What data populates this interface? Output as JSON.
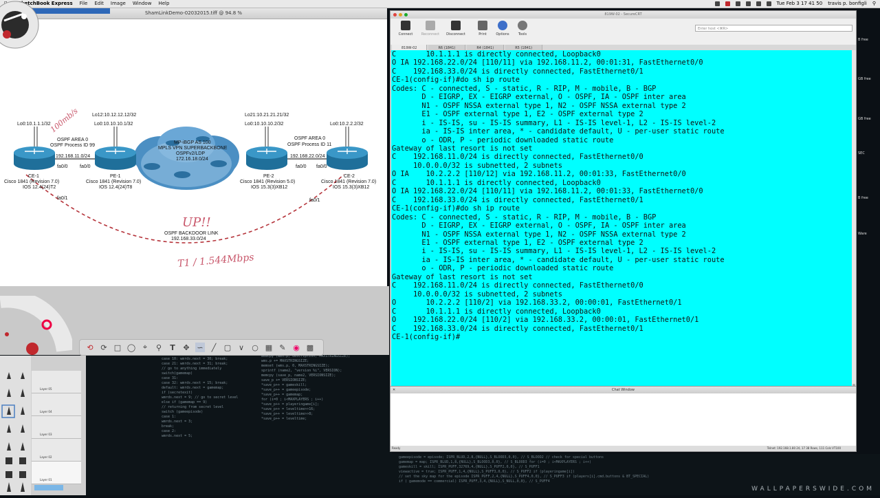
{
  "menubar": {
    "app_name": "SketchBook Express",
    "items": [
      "File",
      "Edit",
      "Image",
      "Window",
      "Help"
    ],
    "clock": "Tue Feb 3  17 41 50",
    "user": "travis p. bonfigli"
  },
  "sketchbook": {
    "window_title": "ShamLinkDemo-02032015.tiff @ 94.8 %",
    "layers": [
      "Layer 05",
      "Layer 04",
      "Layer 03",
      "Layer 02",
      "Layer 01"
    ]
  },
  "diagram": {
    "ce1_lo": "Lo0:10.1.1.1/32",
    "pe1_lo12": "Lo12:10.12.12.12/32",
    "pe1_lo0": "Lo0:10.10.10.1/32",
    "pe2_lo21": "Lo21:10.21.21.21/32",
    "pe2_lo0": "Lo0:10.10.10.2/32",
    "ce2_lo": "Lo0:10.2.2.2/32",
    "ospf_area_left": "OSPF AREA 0",
    "ospf_proc_left": "OSPF Process ID 99",
    "ospf_area_right": "OSPF AREA 0",
    "ospf_proc_right": "OSPF Process ID 11",
    "net_left": "192.168.11.0/24",
    "net_right": "192.168.22.0/24",
    "fa_a": "fa0/0",
    "fa_b": "fa0/0",
    "fa_c": "fa0/0",
    "fa_d": "fa0/0",
    "cloud_1": "MP-iBGP AS 100",
    "cloud_2": "MPLS VPN SUPERBACKBONE",
    "cloud_3": "OSPFv2/LDP",
    "cloud_4": "172.16.18.0/24",
    "ce1_name": "CE-1",
    "ce1_model": "Cisco 1841 (Revision 7.0)",
    "ce1_ios": "IOS 12.4(24)T2",
    "pe1_name": "PE-1",
    "pe1_model": "Cisco 1841 (Revision 7.0)",
    "pe1_ios": "IOS 12.4(24)T8",
    "pe2_name": "PE-2",
    "pe2_model": "Cisco 1841 (Revision 5.0)",
    "pe2_ios": "IOS 15.3(3)XB12",
    "ce2_name": "CE-2",
    "ce2_model": "Cisco 1841 (Revision 7.0)",
    "ce2_ios": "IOS 15.3(3)XB12",
    "fa01_left": "fa0/1",
    "fa01_right": "fa0/1",
    "backdoor": "OSPF BACKDOOR LINK",
    "backdoor_net": "192.168.33.0/24",
    "hand_speed": "100mb/s",
    "hand_up": "UP!!",
    "hand_t1": "T1 / 1.544Mbps"
  },
  "securecrt": {
    "window_title": "819W-02 - SecureCRT",
    "toolbar": [
      "Connect",
      "Reconnect",
      "Disconnect",
      "Print",
      "Options",
      "Tools"
    ],
    "host_placeholder": "Enter host <⌘R>",
    "tabs": [
      "819W-02",
      "R6 (1841)",
      "R4 (1841)",
      "R5 (1841)"
    ],
    "chat_title": "Chat Window",
    "status_left": "Ready",
    "status_right": "Telnet: 192.168.1.80    24, 17   38 Rows, 111 Cols   VT100",
    "terminal_lines": [
      "C       10.1.1.1 is directly connected, Loopback0",
      "O IA 192.168.22.0/24 [110/11] via 192.168.11.2, 00:01:31, FastEthernet0/0",
      "C    192.168.33.0/24 is directly connected, FastEthernet0/1",
      "CE-1(config-if)#do sh ip route",
      "Codes: C - connected, S - static, R - RIP, M - mobile, B - BGP",
      "       D - EIGRP, EX - EIGRP external, O - OSPF, IA - OSPF inter area",
      "       N1 - OSPF NSSA external type 1, N2 - OSPF NSSA external type 2",
      "       E1 - OSPF external type 1, E2 - OSPF external type 2",
      "       i - IS-IS, su - IS-IS summary, L1 - IS-IS level-1, L2 - IS-IS level-2",
      "       ia - IS-IS inter area, * - candidate default, U - per-user static route",
      "       o - ODR, P - periodic downloaded static route",
      "",
      "Gateway of last resort is not set",
      "",
      "C    192.168.11.0/24 is directly connected, FastEthernet0/0",
      "     10.0.0.0/32 is subnetted, 2 subnets",
      "O IA    10.2.2.2 [110/12] via 192.168.11.2, 00:01:33, FastEthernet0/0",
      "C       10.1.1.1 is directly connected, Loopback0",
      "O IA 192.168.22.0/24 [110/11] via 192.168.11.2, 00:01:33, FastEthernet0/0",
      "C    192.168.33.0/24 is directly connected, FastEthernet0/1",
      "CE-1(config-if)#do sh ip route",
      "Codes: C - connected, S - static, R - RIP, M - mobile, B - BGP",
      "       D - EIGRP, EX - EIGRP external, O - OSPF, IA - OSPF inter area",
      "       N1 - OSPF NSSA external type 1, N2 - OSPF NSSA external type 2",
      "       E1 - OSPF external type 1, E2 - OSPF external type 2",
      "       i - IS-IS, su - IS-IS summary, L1 - IS-IS level-1, L2 - IS-IS level-2",
      "       ia - IS-IS inter area, * - candidate default, U - per-user static route",
      "       o - ODR, P - periodic downloaded static route",
      "",
      "Gateway of last resort is not set",
      "",
      "C    192.168.11.0/24 is directly connected, FastEthernet0/0",
      "     10.0.0.0/32 is subnetted, 2 subnets",
      "O       10.2.2.2 [110/2] via 192.168.33.2, 00:00:01, FastEthernet0/1",
      "C       10.1.1.1 is directly connected, Loopback0",
      "O    192.168.22.0/24 [110/2] via 192.168.33.2, 00:00:01, FastEthernet0/1",
      "C    192.168.33.0/24 is directly connected, FastEthernet0/1",
      "CE-1(config-if)#"
    ]
  },
  "desktop": {
    "code_left": [
      "case 10: wmrds.next = 30; break;",
      "case 21: wmrds.next = 31; break;",
      "// go to anything immediately",
      "switch(gamemap)",
      "case 31:",
      "case 32: wmrds.next = 15; break;",
      "default: wmrds.next = gamemap;",
      "if (secretexit)",
      "  wmrds.next = 9;     // go to secret level",
      "else if (gamemap == 9)",
      "// returning from secret level",
      "switch (gameepisode)",
      "case 1:",
      "  wmrds.next = 3;",
      "  break;",
      "case 2:",
      "  wmrds.next = 5;"
    ],
    "code_mid": [
      "memcpy (wms.p, description, MAXSTRINGSIZE);",
      "wms.p += MAXSTRINGSIZE;",
      "memset (wms.p, 0, MAXSTRINGSIZE);",
      "sprintf (name2, \"version %i\", VERSION);",
      "memcpy (save_p, name2, VERSIONSIZE);",
      "save_p += VERSIONSIZE;",
      "*save_p++ = gameskill;",
      "*save_p++ = gameepisode;",
      "*save_p++ = gamemap;",
      "for (i=0 ; i<MAXPLAYERS ; i++)",
      "  *save_p++ = playeringame[i];",
      "*save_p++ = leveltime>>16;",
      "*save_p++ = leveltime>>8;",
      "*save_p++ = leveltime;"
    ],
    "code_bottom": [
      "gameepisode = episode;    ISPR_BLUD,2,8,{NULL},S_BLOOD3,0,0},   // S_BLOOD2     // check for special buttons",
      "gamemap = map;            ISPR_BLUD,1,8,{NULL},S_BLOOD3,0,0},   // S_BLOOD3     for (i=0 ; i<MAXPLAYERS ; i++)",
      "gameskill = skill;        ISPR_PUFF,32769,4,{NULL},S_PUFF2,0,0}, // S_PUFF1",
      "viewactive = true;        ISPR_PUFF,1,4,{NULL},S_PUFF3,0,0},     // S_PUFF2      if (playeringame[i])",
      "// set the sky map for the episode  ISPR_PUFF,2,4,{NULL},S_PUFF4,0,0}, // S_PUFF3  if (players[i].cmd.buttons & BT_SPECIAL)",
      "if ( gamemode == commercial)        ISPR_PUFF,3,4,{NULL},S_NULL,0,0},  // S_PUFF4"
    ],
    "side_labels": [
      "B free",
      "GB free",
      "GB free",
      "SEC",
      "B free",
      "Ware"
    ],
    "watermark": "WALLPAPERSWIDE.COM"
  }
}
